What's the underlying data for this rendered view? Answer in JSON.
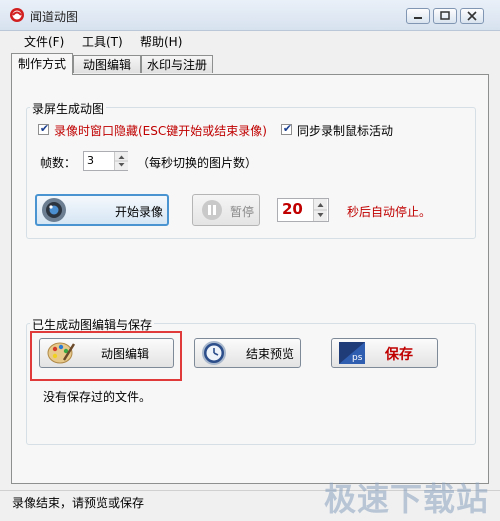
{
  "window": {
    "title": "闻道动图"
  },
  "menu": {
    "file": "文件(F)",
    "tools": "工具(T)",
    "help": "帮助(H)"
  },
  "tabs": {
    "method": "制作方式",
    "edit": "动图编辑",
    "watermark": "水印与注册"
  },
  "record_group": {
    "legend": "录屏生成动图",
    "hide_window_label": "录像时窗口隐藏(ESC键开始或结束录像)",
    "hide_window_checked": true,
    "sync_mouse_label": "同步录制鼠标活动",
    "sync_mouse_checked": true,
    "fps_label": "帧数：",
    "fps_value": "3",
    "fps_hint": "（每秒切换的图片数）",
    "start_button": "开始录像",
    "pause_button": "暂停",
    "auto_stop_value": "20",
    "auto_stop_label": "秒后自动停止。"
  },
  "edit_group": {
    "legend": "已生成动图编辑与保存",
    "anim_edit_button": "动图编辑",
    "end_preview_button": "结束预览",
    "save_button": "保存",
    "no_file_text": "没有保存过的文件。"
  },
  "status": {
    "text": "录像结束，请预览或保存"
  },
  "watermark": {
    "text": "极速下载站"
  },
  "icons": {
    "app": "app-logo-icon",
    "camera": "camera-lens-icon",
    "pause": "pause-icon",
    "palette": "palette-icon",
    "clock": "clock-icon",
    "ps": "photoshop-icon"
  },
  "colors": {
    "accent_red": "#c00000",
    "highlight": "#e03a3a",
    "focus_blue": "#4a95d1"
  }
}
